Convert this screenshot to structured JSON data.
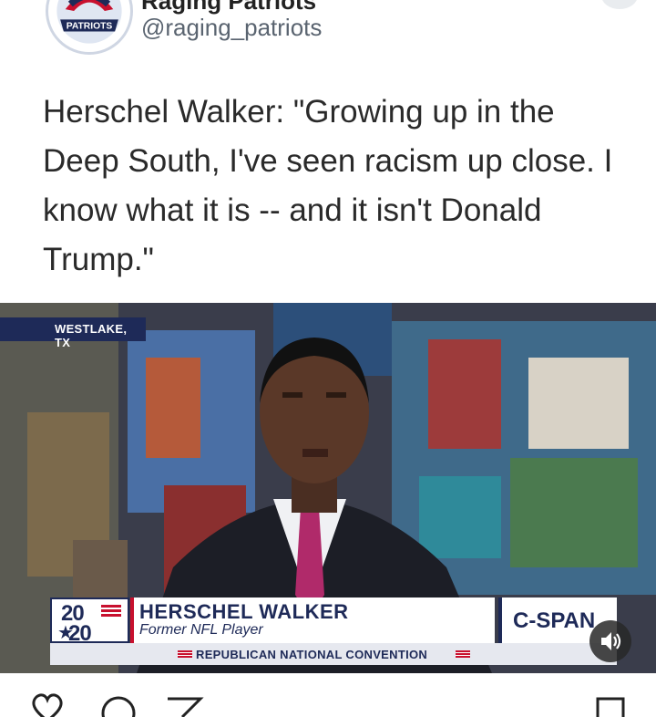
{
  "post": {
    "account_name": "Raging Patriots",
    "handle": "@raging_patriots",
    "avatar_text": "PATRIOTS",
    "quote": "Herschel Walker: \"Growing up in the Deep South, I've seen racism up close. I know what it is -- and it isn't Donald Trump.\""
  },
  "video": {
    "location": "WESTLAKE, TX",
    "logo_year_top": "20",
    "logo_year_bottom": "20",
    "speaker_name": "HERSCHEL WALKER",
    "speaker_title": "Former NFL Player",
    "network": "C-SPAN",
    "ticker": "REPUBLICAN NATIONAL CONVENTION"
  },
  "icons": [
    "more-icon",
    "sound-icon",
    "heart-icon",
    "comment-icon",
    "share-icon",
    "bookmark-icon"
  ],
  "colors": {
    "navy": "#1e2a58",
    "red": "#c8102e",
    "text": "#2a2a2a",
    "handle": "#5a6470"
  }
}
